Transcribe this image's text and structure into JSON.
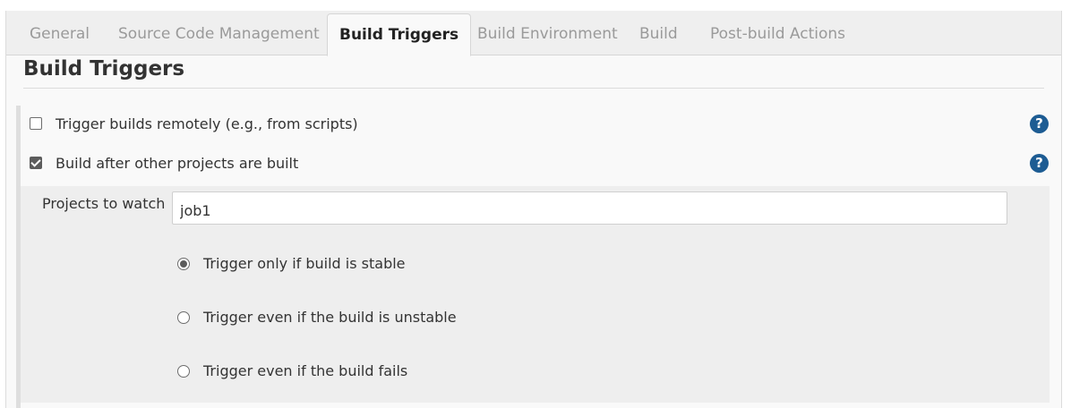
{
  "tabs": [
    {
      "label": "General",
      "active": false
    },
    {
      "label": "Source Code Management",
      "active": false
    },
    {
      "label": "Build Triggers",
      "active": true
    },
    {
      "label": "Build Environment",
      "active": false
    },
    {
      "label": "Build",
      "active": false
    },
    {
      "label": "Post-build Actions",
      "active": false
    }
  ],
  "section": {
    "title": "Build Triggers"
  },
  "triggers": [
    {
      "label": "Trigger builds remotely (e.g., from scripts)",
      "checked": false,
      "help_icon": "question-icon"
    },
    {
      "label": "Build after other projects are built",
      "checked": true,
      "help_icon": "question-icon"
    }
  ],
  "help_glyph": "?",
  "projects": {
    "label": "Projects to watch",
    "value": "job1"
  },
  "radio_options": [
    {
      "label": "Trigger only if build is stable",
      "selected": true
    },
    {
      "label": "Trigger even if the build is unstable",
      "selected": false
    },
    {
      "label": "Trigger even if the build fails",
      "selected": false
    }
  ],
  "colors": {
    "help_icon": "#1d5c93",
    "tab_inactive_text": "#9a9a9a",
    "panel_bg": "#eeeeee"
  }
}
